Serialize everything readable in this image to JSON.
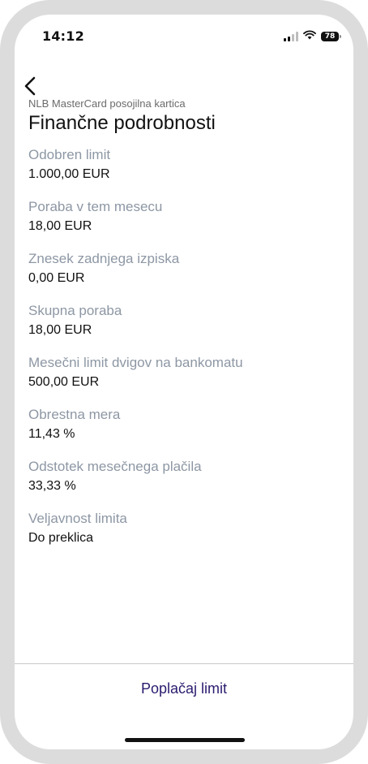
{
  "status_bar": {
    "time": "14:12",
    "battery_level": "78"
  },
  "header": {
    "subtitle": "NLB MasterCard posojilna kartica",
    "title": "Finančne podrobnosti"
  },
  "details": [
    {
      "label": "Odobren limit",
      "value": "1.000,00 EUR"
    },
    {
      "label": "Poraba v tem mesecu",
      "value": "18,00 EUR"
    },
    {
      "label": "Znesek zadnjega izpiska",
      "value": "0,00 EUR"
    },
    {
      "label": "Skupna poraba",
      "value": "18,00 EUR"
    },
    {
      "label": "Mesečni limit dvigov na bankomatu",
      "value": "500,00 EUR"
    },
    {
      "label": "Obrestna mera",
      "value": "11,43 %"
    },
    {
      "label": "Odstotek mesečnega plačila",
      "value": "33,33 %"
    },
    {
      "label": "Veljavnost limita",
      "value": "Do preklica"
    }
  ],
  "footer": {
    "repay_label": "Poplačaj limit"
  },
  "colors": {
    "label_gray": "#8d97a4",
    "action_purple": "#2b1b6e"
  },
  "icons": [
    "signal-icon",
    "wifi-icon",
    "battery-icon",
    "back-chevron-icon"
  ]
}
